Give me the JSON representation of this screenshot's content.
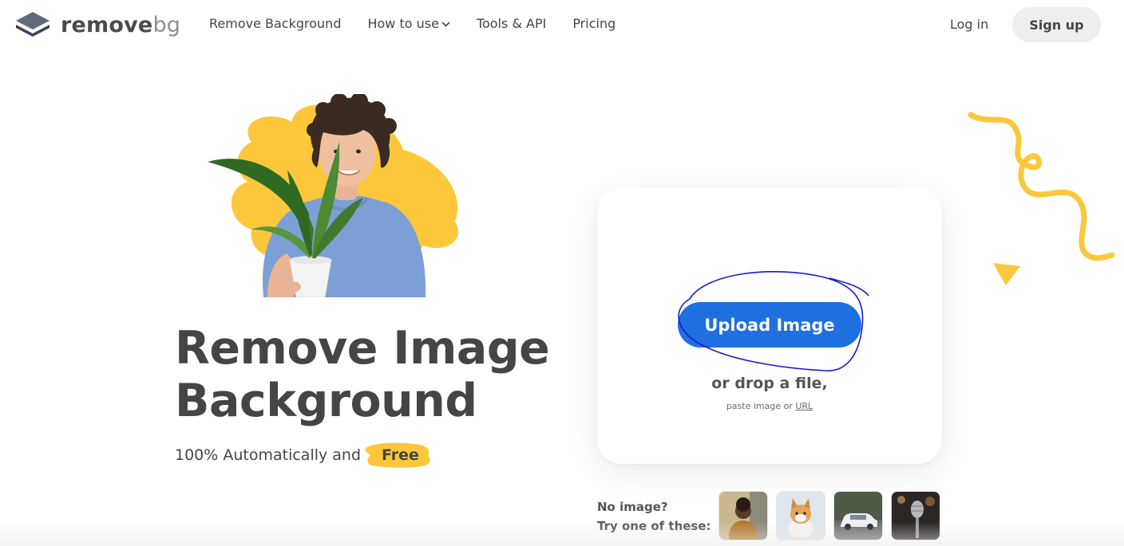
{
  "header": {
    "logo": {
      "word1": "remove",
      "word2": "bg"
    },
    "nav": [
      {
        "label": "Remove Background"
      },
      {
        "label": "How to use"
      },
      {
        "label": "Tools & API"
      },
      {
        "label": "Pricing"
      }
    ],
    "login_label": "Log in",
    "signup_label": "Sign up"
  },
  "hero": {
    "title_line1": "Remove Image",
    "title_line2": "Background",
    "subtitle": "100% Automatically and",
    "free_label": "Free"
  },
  "upload": {
    "button_label": "Upload Image",
    "drop_text": "or drop a file,",
    "paste_text": "paste image or",
    "url_label": "URL"
  },
  "samples": {
    "line1": "No image?",
    "line2": "Try one of these:",
    "thumbs": [
      "person",
      "dog",
      "car",
      "microphone"
    ]
  },
  "colors": {
    "accent_blue": "#1e6fe0",
    "brand_yellow": "#fcc73a",
    "annotation_blue": "#1a1ad0",
    "text": "#454545"
  }
}
